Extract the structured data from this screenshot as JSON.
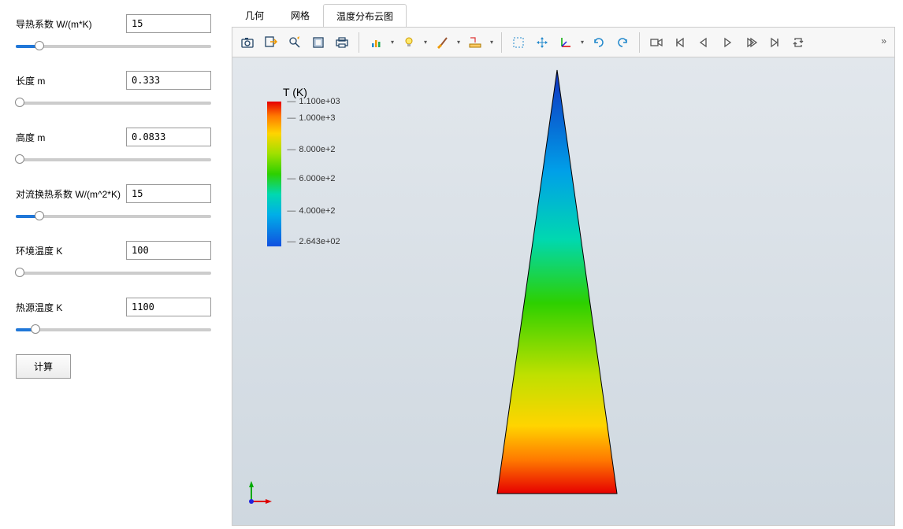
{
  "params": [
    {
      "label": "导热系数 W/(m*K)",
      "value": "15",
      "pct": 12
    },
    {
      "label": "长度 m",
      "value": "0.333",
      "pct": 2
    },
    {
      "label": "高度 m",
      "value": "0.0833",
      "pct": 2
    },
    {
      "label": "对流换热系数 W/(m^2*K)",
      "value": "15",
      "pct": 12
    },
    {
      "label": "环境温度 K",
      "value": "100",
      "pct": 2
    },
    {
      "label": "热源温度 K",
      "value": "1100",
      "pct": 10
    }
  ],
  "compute_button": "计算",
  "tabs": [
    {
      "label": "几何",
      "active": false
    },
    {
      "label": "网格",
      "active": false
    },
    {
      "label": "温度分布云图",
      "active": true
    }
  ],
  "toolbar": {
    "items": [
      {
        "name": "camera-icon",
        "tip": "screenshot"
      },
      {
        "name": "export-icon",
        "tip": "export"
      },
      {
        "name": "zoom-magnify-icon",
        "tip": "zoom-search"
      },
      {
        "name": "layer-box-icon",
        "tip": "scene"
      },
      {
        "name": "print-icon",
        "tip": "print"
      },
      {
        "sep": true
      },
      {
        "name": "graph-icon",
        "tip": "graph",
        "dd": true
      },
      {
        "name": "lightbulb-icon",
        "tip": "light",
        "dd": true
      },
      {
        "name": "brush-icon",
        "tip": "brush",
        "dd": true
      },
      {
        "name": "ruler-icon",
        "tip": "measure",
        "dd": true
      },
      {
        "sep": true
      },
      {
        "name": "select-box-icon",
        "tip": "select"
      },
      {
        "name": "move-arrows-icon",
        "tip": "pan"
      },
      {
        "name": "axes-icon",
        "tip": "axes",
        "dd": true
      },
      {
        "name": "rotate-cw-icon",
        "tip": "rotate"
      },
      {
        "name": "rotate-ccw-icon",
        "tip": "rotate-back"
      },
      {
        "sep": true
      },
      {
        "name": "video-camera-icon",
        "tip": "record"
      },
      {
        "name": "first-frame-icon",
        "tip": "first"
      },
      {
        "name": "prev-frame-icon",
        "tip": "prev"
      },
      {
        "name": "play-icon",
        "tip": "play"
      },
      {
        "name": "next-frame-icon",
        "tip": "next"
      },
      {
        "name": "last-frame-icon",
        "tip": "last"
      },
      {
        "name": "repeat-icon",
        "tip": "repeat"
      }
    ]
  },
  "legend": {
    "title": "T (K)",
    "ticks": [
      {
        "label": "1.100e+03",
        "pos": 0
      },
      {
        "label": "1.000e+3",
        "pos": 12
      },
      {
        "label": "8.000e+2",
        "pos": 34
      },
      {
        "label": "6.000e+2",
        "pos": 55
      },
      {
        "label": "4.000e+2",
        "pos": 78
      },
      {
        "label": "2.643e+02",
        "pos": 100
      }
    ]
  },
  "chart_data": {
    "type": "contour",
    "variable": "T",
    "unit": "K",
    "range": [
      264.3,
      1100
    ],
    "colormap": "jet-reversed",
    "geometry": "triangle-fin",
    "gradient_direction": "vertical",
    "temperature_at_base": 1100,
    "temperature_at_tip": 264.3
  }
}
